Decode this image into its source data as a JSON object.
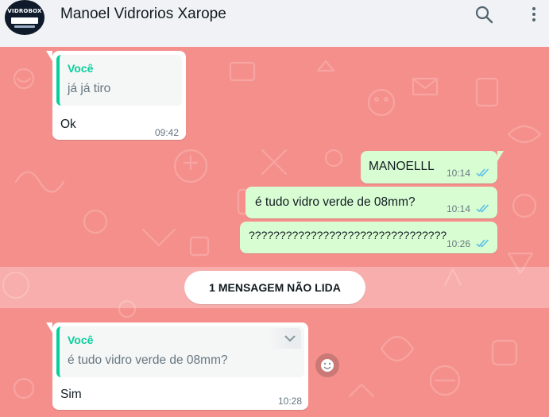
{
  "header": {
    "contact_name": "Manoel Vidrorios Xarope",
    "avatar_logo_text": "VIDROBOX",
    "search_icon": "search-icon",
    "menu_icon": "kebab-menu-icon"
  },
  "colors": {
    "header_bg": "#f0f2f5",
    "chat_wallpaper": "#f58f8c",
    "incoming_bubble": "#ffffff",
    "outgoing_bubble": "#d9fdd3",
    "quote_accent": "#06cf9c",
    "read_ticks": "#53bdeb"
  },
  "messages": [
    {
      "direction": "incoming",
      "quote_author": "Você",
      "quote_text": "já já tiro",
      "text": "Ok",
      "time": "09:42"
    },
    {
      "direction": "outgoing",
      "text": "MANOELLL",
      "time": "10:14",
      "status": "read"
    },
    {
      "direction": "outgoing",
      "text": "é tudo vidro verde de 08mm?",
      "time": "10:14",
      "status": "read"
    },
    {
      "direction": "outgoing",
      "text": "????????????????????????????????",
      "time": "10:26",
      "status": "read"
    },
    {
      "direction": "incoming",
      "quote_author": "Você",
      "quote_text": "é tudo vidro verde de 08mm?",
      "text": "Sim",
      "time": "10:28"
    }
  ],
  "unread_banner": "1 MENSAGEM NÃO LIDA"
}
